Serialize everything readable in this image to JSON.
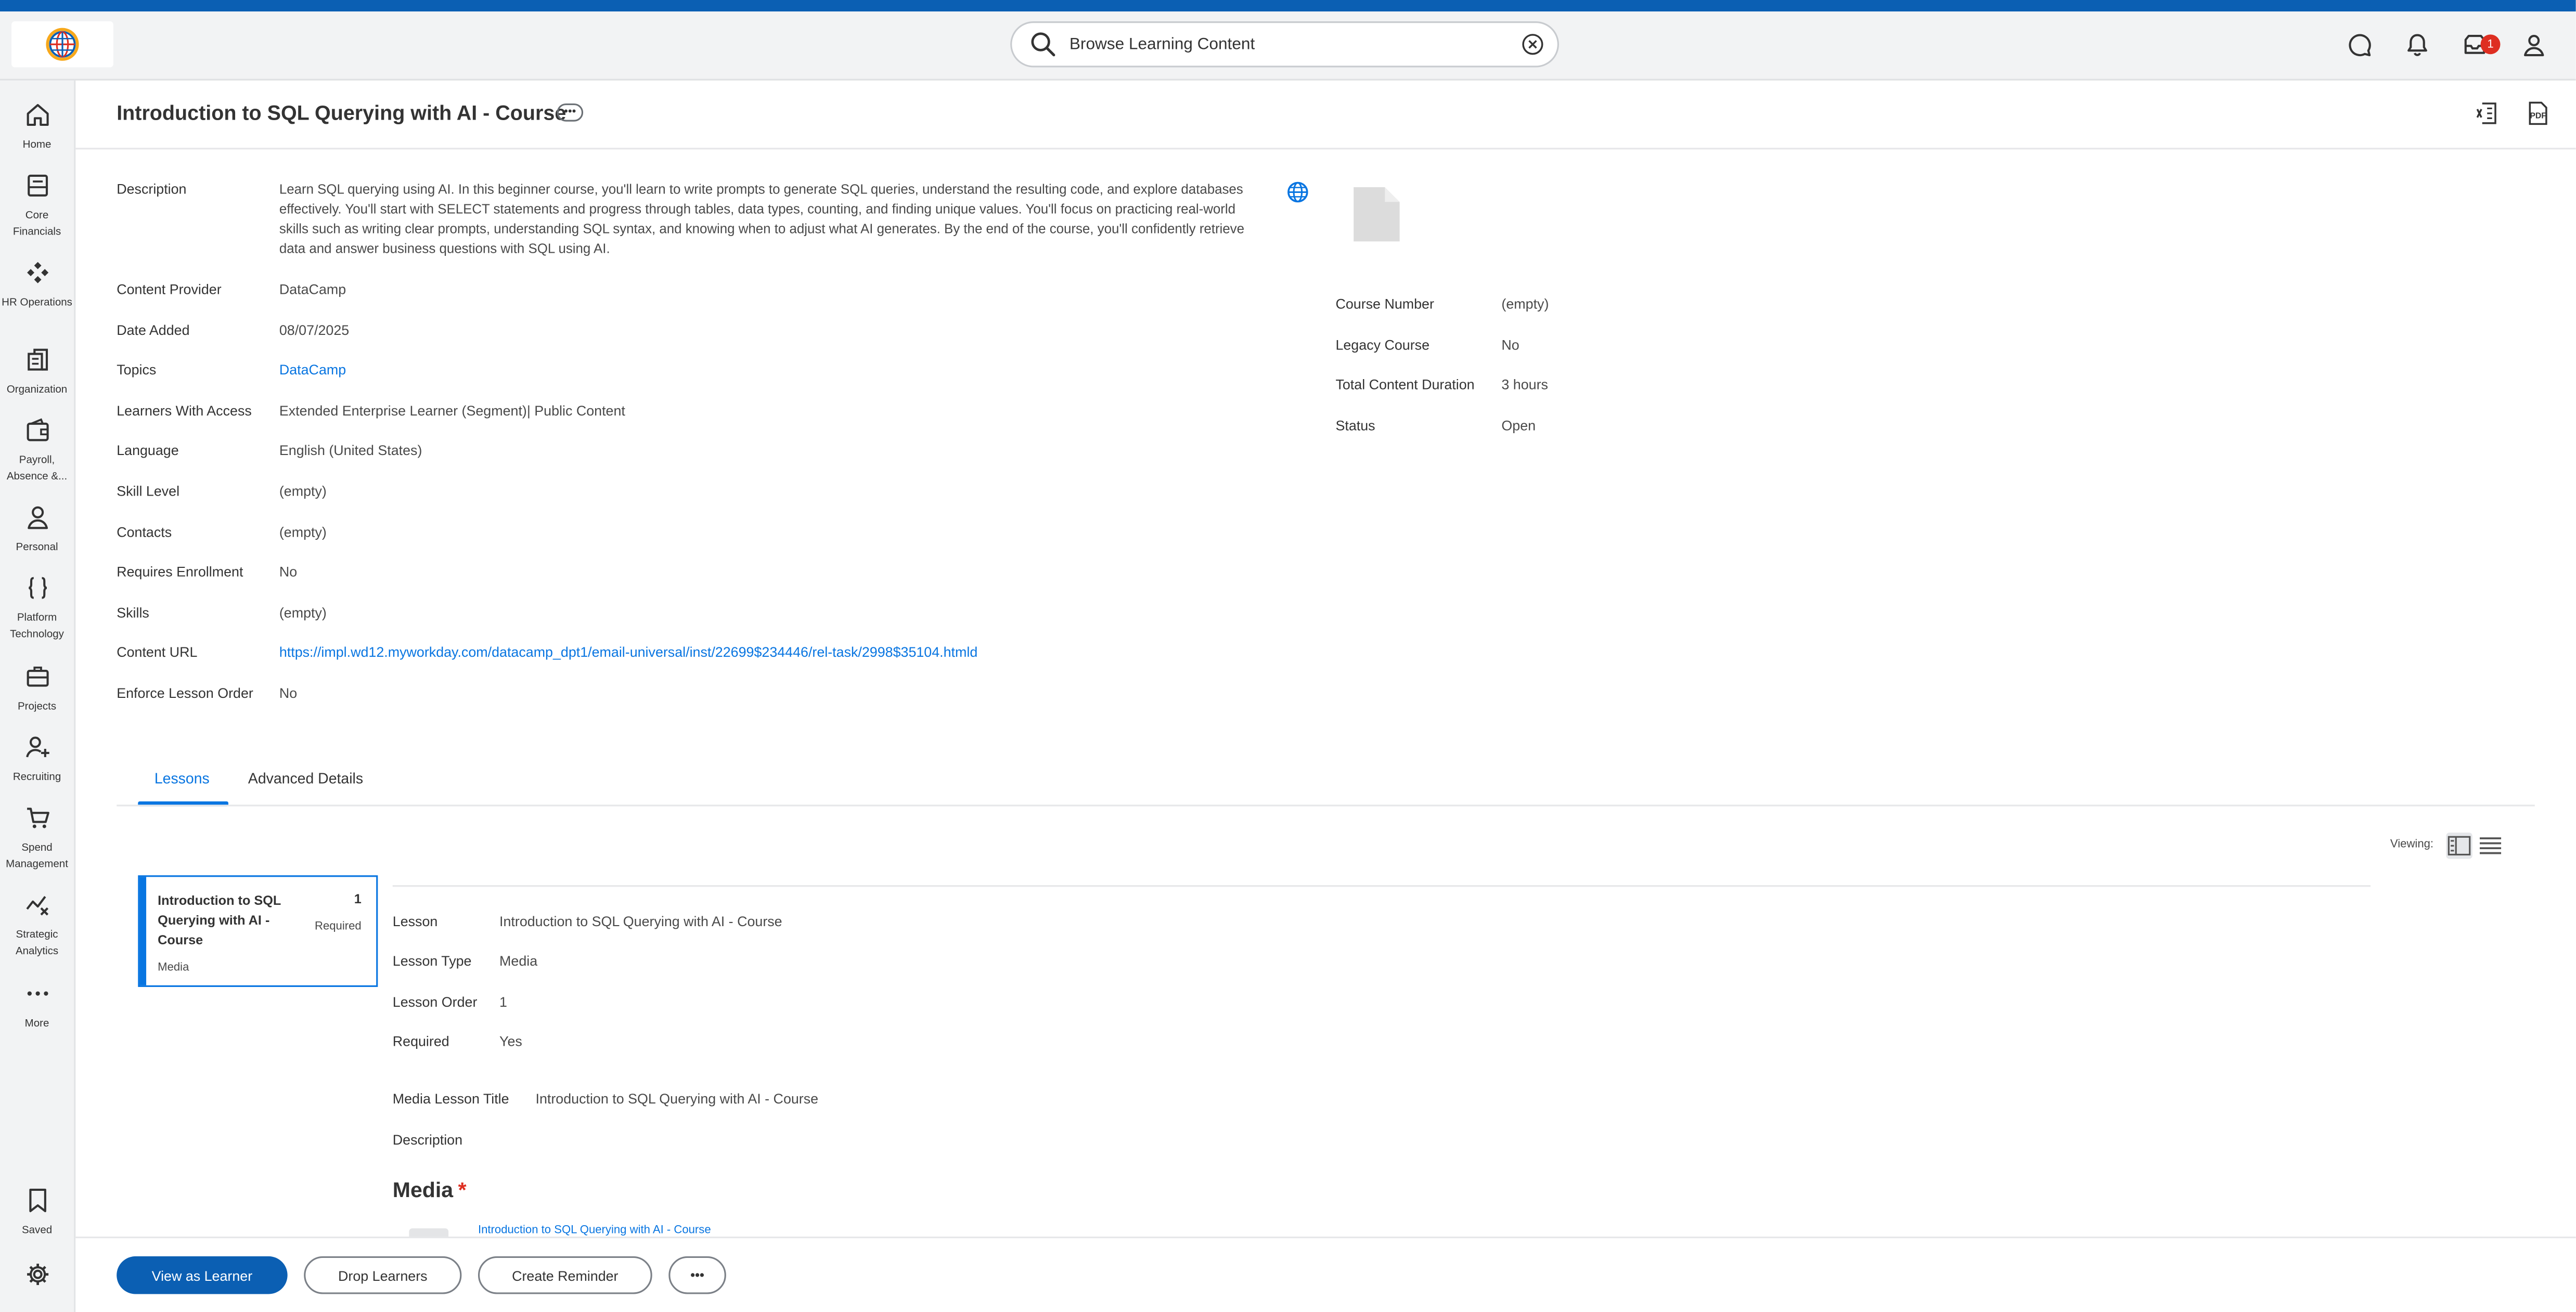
{
  "header": {
    "search_text": "Browse Learning Content",
    "inbox_count": "1",
    "icons": [
      "globe-logo-icon",
      "search-icon",
      "clear-icon",
      "chat-icon",
      "notifications-icon",
      "inbox-icon",
      "profile-icon"
    ]
  },
  "sidebar": {
    "items": [
      {
        "label": "Home",
        "icon": "home-icon"
      },
      {
        "label": "Core Financials",
        "icon": "ledger-icon"
      },
      {
        "label": "HR Operations",
        "icon": "diamonds-icon"
      },
      {
        "label": "Organization",
        "icon": "building-icon"
      },
      {
        "label": "Payroll, Absence &...",
        "icon": "wallet-icon"
      },
      {
        "label": "Personal",
        "icon": "person-icon"
      },
      {
        "label": "Platform Technology",
        "icon": "braces-icon"
      },
      {
        "label": "Projects",
        "icon": "briefcase-icon"
      },
      {
        "label": "Recruiting",
        "icon": "add-person-icon"
      },
      {
        "label": "Spend Management",
        "icon": "cart-icon"
      },
      {
        "label": "Strategic Analytics",
        "icon": "analytics-icon"
      },
      {
        "label": "More",
        "icon": "ellipsis-icon"
      }
    ],
    "saved_label": "Saved"
  },
  "page": {
    "title": "Introduction to SQL Querying with AI - Course",
    "more_label": "•••"
  },
  "details": {
    "description_label": "Description",
    "description": "Learn SQL querying using AI. In this beginner course, you'll learn to write prompts to generate SQL queries, understand the resulting code, and explore databases effectively. You'll start with SELECT statements and progress through tables, data types, counting, and finding unique values. You'll focus on practicing real-world skills such as writing clear prompts, understanding SQL syntax, and knowing when to adjust what AI generates. By the end of the course, you'll confidently retrieve data and answer business questions with SQL using AI.",
    "left": [
      {
        "label": "Content Provider",
        "value": "DataCamp",
        "link": false
      },
      {
        "label": "Date Added",
        "value": "08/07/2025",
        "link": false
      },
      {
        "label": "Topics",
        "value": "DataCamp",
        "link": true
      },
      {
        "label": "Learners With Access",
        "value": "Extended Enterprise Learner (Segment)| Public Content",
        "link": false
      },
      {
        "label": "Language",
        "value": "English (United States)",
        "link": false
      },
      {
        "label": "Skill Level",
        "value": "(empty)",
        "link": false
      },
      {
        "label": "Contacts",
        "value": "(empty)",
        "link": false
      },
      {
        "label": "Requires Enrollment",
        "value": "No",
        "link": false
      },
      {
        "label": "Skills",
        "value": "(empty)",
        "link": false
      },
      {
        "label": "Content URL",
        "value": "https://impl.wd12.myworkday.com/datacamp_dpt1/email-universal/inst/22699$234446/rel-task/2998$35104.htmld",
        "link": true
      },
      {
        "label": "Enforce Lesson Order",
        "value": "No",
        "link": false
      }
    ],
    "right": [
      {
        "label": "Course Number",
        "value": "(empty)"
      },
      {
        "label": "Legacy Course",
        "value": "No"
      },
      {
        "label": "Total Content Duration",
        "value": "3 hours"
      },
      {
        "label": "Status",
        "value": "Open"
      }
    ]
  },
  "tabs": [
    {
      "label": "Lessons",
      "active": true
    },
    {
      "label": "Advanced Details",
      "active": false
    }
  ],
  "lessons_view": {
    "viewing_label": "Viewing:",
    "card": {
      "title": "Introduction to SQL Querying with AI - Course",
      "number": "1",
      "required": "Required",
      "type": "Media"
    },
    "fields": [
      {
        "label": "Lesson",
        "value": "Introduction to SQL Querying with AI - Course"
      },
      {
        "label": "Lesson Type",
        "value": "Media"
      },
      {
        "label": "Lesson Order",
        "value": "1"
      },
      {
        "label": "Required",
        "value": "Yes"
      }
    ],
    "media_title_label": "Media Lesson Title",
    "media_title_value": "Introduction to SQL Querying with AI - Course",
    "description_label": "Description",
    "media_heading": "Media",
    "media_required_mark": "*",
    "media_link": "Introduction to SQL Querying with AI - Course"
  },
  "actions": {
    "view_as_learner": "View as Learner",
    "drop_learners": "Drop Learners",
    "create_reminder": "Create Reminder",
    "more": "•••"
  },
  "colors": {
    "brand_blue": "#0b5fb3",
    "link_blue": "#0875e1",
    "badge_red": "#de2e21"
  }
}
